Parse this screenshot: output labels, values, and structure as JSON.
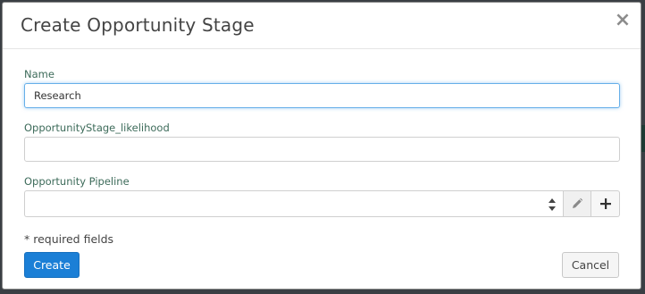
{
  "dialog": {
    "title": "Create Opportunity Stage",
    "close_symbol": "×"
  },
  "fields": {
    "name": {
      "label": "Name",
      "value": "Research"
    },
    "likelihood": {
      "label": "OpportunityStage_likelihood",
      "value": ""
    },
    "pipeline": {
      "label": "Opportunity Pipeline",
      "selected": ""
    }
  },
  "icons": {
    "close": "close-icon",
    "select_arrows": "select-arrows-icon",
    "edit": "pencil-icon",
    "add": "plus-icon"
  },
  "footer": {
    "required_note": "* required fields",
    "create_label": "Create",
    "cancel_label": "Cancel"
  },
  "colors": {
    "primary": "#1b7fd6",
    "label": "#3d6b5a",
    "focus": "#66afe9"
  }
}
